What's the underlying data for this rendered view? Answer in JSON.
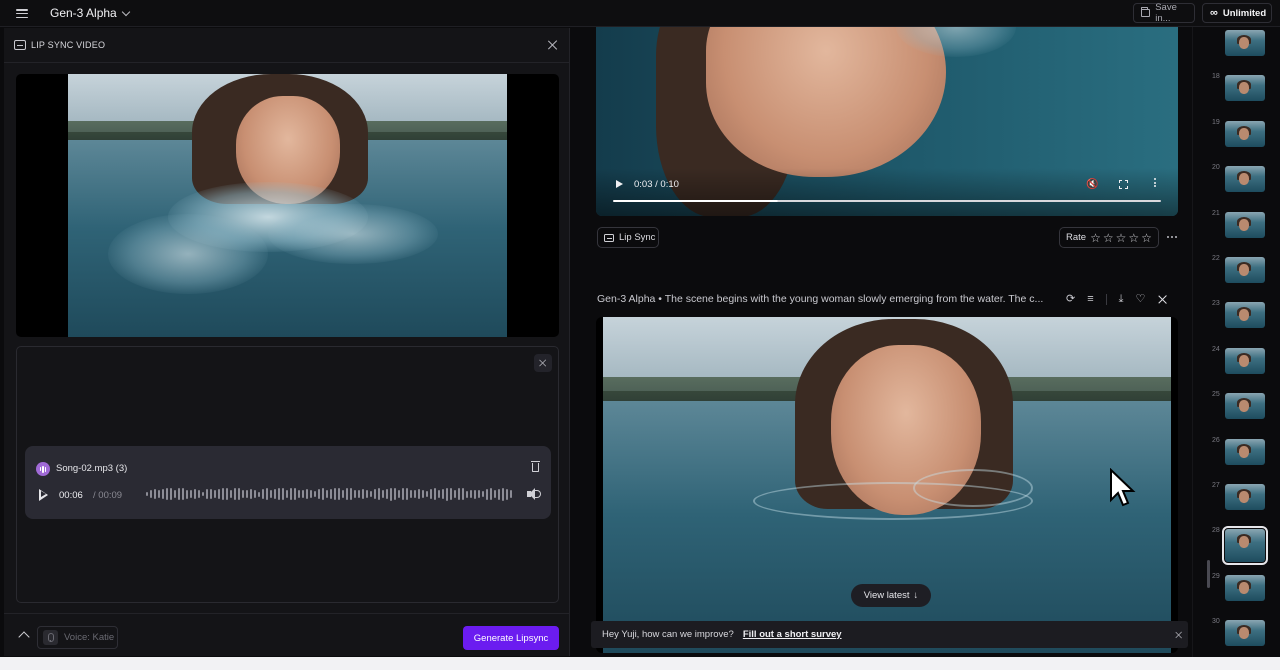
{
  "topbar": {
    "title": "Gen-3 Alpha",
    "save_label": "Save in...",
    "plan_label": "Unlimited"
  },
  "lipsync_panel": {
    "title": "LIP SYNC VIDEO",
    "audio": {
      "file_name": "Song-02.mp3 (3)",
      "current_time": "00:06",
      "separator": " / ",
      "total_time": "00:09"
    },
    "voice_placeholder": "Voice: Katie",
    "generate_label": "Generate Lipsync"
  },
  "feed": {
    "video1": {
      "time": "0:03 / 0:10",
      "progress": 0.3
    },
    "lipsync_label": "Lip Sync",
    "rate_label": "Rate",
    "rating_stars": 5,
    "generation_caption": "Gen-3 Alpha • The scene begins with the young woman slowly emerging from the water. The c...",
    "view_latest_label": "View latest",
    "survey": {
      "message": "Hey Yuji, how can we improve?",
      "link": "Fill out a short survey"
    }
  },
  "rail": {
    "thumbnails": [
      {
        "num": ""
      },
      {
        "num": "18"
      },
      {
        "num": "19"
      },
      {
        "num": "20"
      },
      {
        "num": "21"
      },
      {
        "num": "22"
      },
      {
        "num": "23"
      },
      {
        "num": "24"
      },
      {
        "num": "25"
      },
      {
        "num": "26"
      },
      {
        "num": "27"
      },
      {
        "num": "28",
        "selected": true
      },
      {
        "num": "29"
      },
      {
        "num": "30"
      }
    ]
  },
  "colors": {
    "accent": "#6b1cf0",
    "background": "#0b0b0d",
    "panel": "#141417"
  }
}
